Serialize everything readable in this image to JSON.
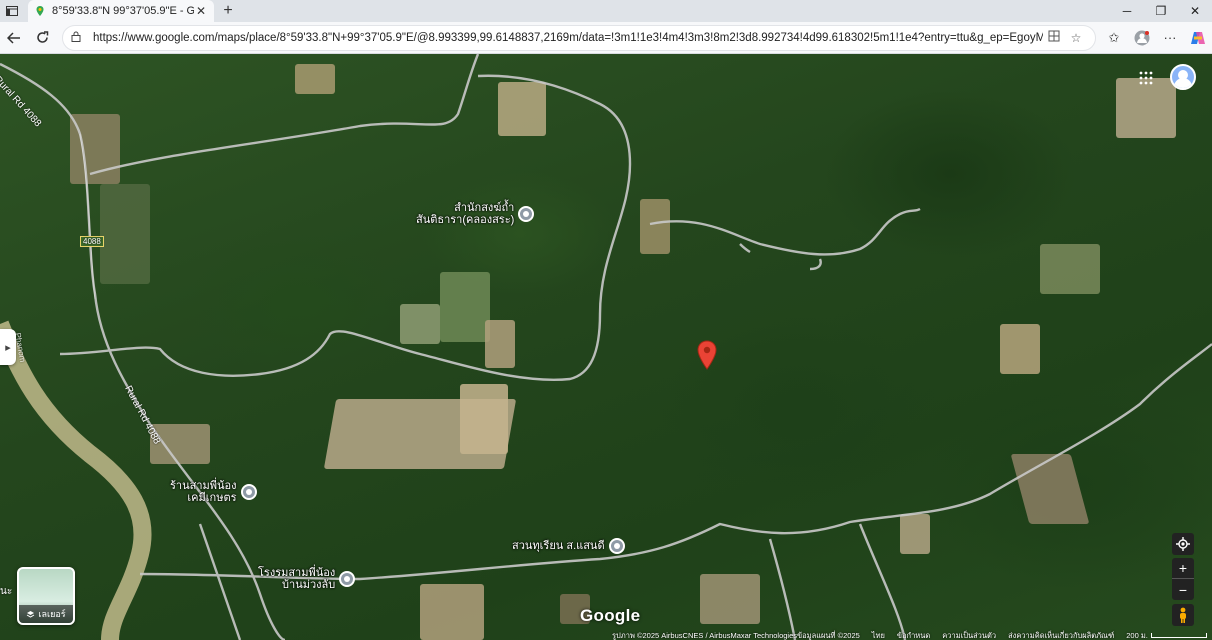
{
  "browser": {
    "tab_title": "8°59'33.8\"N 99°37'05.9\"E - Googl",
    "tab_close": "✕",
    "new_tab": "+",
    "window_controls": {
      "minimize": "─",
      "maximize": "❐",
      "close": "✕"
    },
    "url": "https://www.google.com/maps/place/8°59'33.8\"N+99°37'05.9\"E/@8.993399,99.6148837,2169m/data=!3m1!1e3!4m4!3m3!8m2!3d8.992734!4d99.618302!5m1!1e4?entry=ttu&g_ep=EgoyMDI1MDUxMy4x..."
  },
  "map": {
    "places": [
      {
        "label_line1": "สำนักสงฆ์ถ้ำ",
        "label_line2": "สันติธารา(คลองสระ)"
      },
      {
        "label_line1": "ร้านสามพี่น้อง",
        "label_line2": "เคมีเกษตร"
      },
      {
        "label_line1": "สวนทุเรียน ส.แสนดี",
        "label_line2": ""
      },
      {
        "label_line1": "โรงรมสามพี่น้อง",
        "label_line2": "บ้านม่วงลับ"
      }
    ],
    "road_labels": [
      "Rural Rd 4088",
      "Rural Rd 4088",
      "4088",
      "Phanom"
    ],
    "layers_label": "เลเยอร์",
    "left_cut_text": "นะ",
    "logo": "Google",
    "footer": {
      "imagery": "รูปภาพ ©2025 AirbusCNES / AirbusMaxar Technologiesข้อมูลแผนที่ ©2025",
      "lang": "ไทย",
      "terms": "ข้อกำหนด",
      "privacy": "ความเป็นส่วนตัว",
      "feedback": "ส่งความคิดเห็นเกี่ยวกับผลิตภัณฑ์",
      "scale": "200 ม."
    },
    "controls": {
      "zoom_in": "+",
      "zoom_out": "−"
    }
  },
  "colors": {
    "marker": "#ea4335",
    "road": "#c8c8c8"
  }
}
